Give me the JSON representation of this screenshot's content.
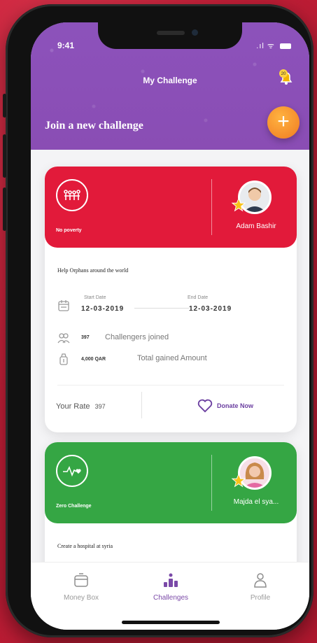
{
  "status_bar": {
    "time": "9:41",
    "signal": ".ıl",
    "wifi": "ᯤ"
  },
  "header": {
    "title": "My Challenge",
    "bell_badge": "20",
    "join_label": "Join a new challenge",
    "add_label": "+"
  },
  "cards": [
    {
      "color": "#e21a3a",
      "icon": "family-icon",
      "name": "No poverty",
      "owner": "Adam Bashir",
      "description": "Help Orphans around the world",
      "start_label": "Start Date",
      "start_date": "12-03-2019",
      "end_label": "End Date",
      "end_date": "12-03-2019",
      "joined_count": "397",
      "joined_label": "Challengers joined",
      "amount": "4,000 QAR",
      "amount_label": "Total gained Amount",
      "rate_label": "Your Rate",
      "rate_value": "397",
      "donate_label": "Donate Now"
    },
    {
      "color": "#35a644",
      "icon": "heartbeat-icon",
      "name": "Zero Challenge",
      "owner": "Majda el sya...",
      "description": "Create a hospital at syria"
    }
  ],
  "tabs": [
    {
      "label": "Money Box",
      "icon": "moneybox-icon",
      "active": false
    },
    {
      "label": "Challenges",
      "icon": "challenges-icon",
      "active": true
    },
    {
      "label": "Profile",
      "icon": "profile-icon",
      "active": false
    }
  ],
  "colors": {
    "header": "#8a4fb8",
    "accent": "#f28c28",
    "purple_text": "#6b3fa0"
  }
}
